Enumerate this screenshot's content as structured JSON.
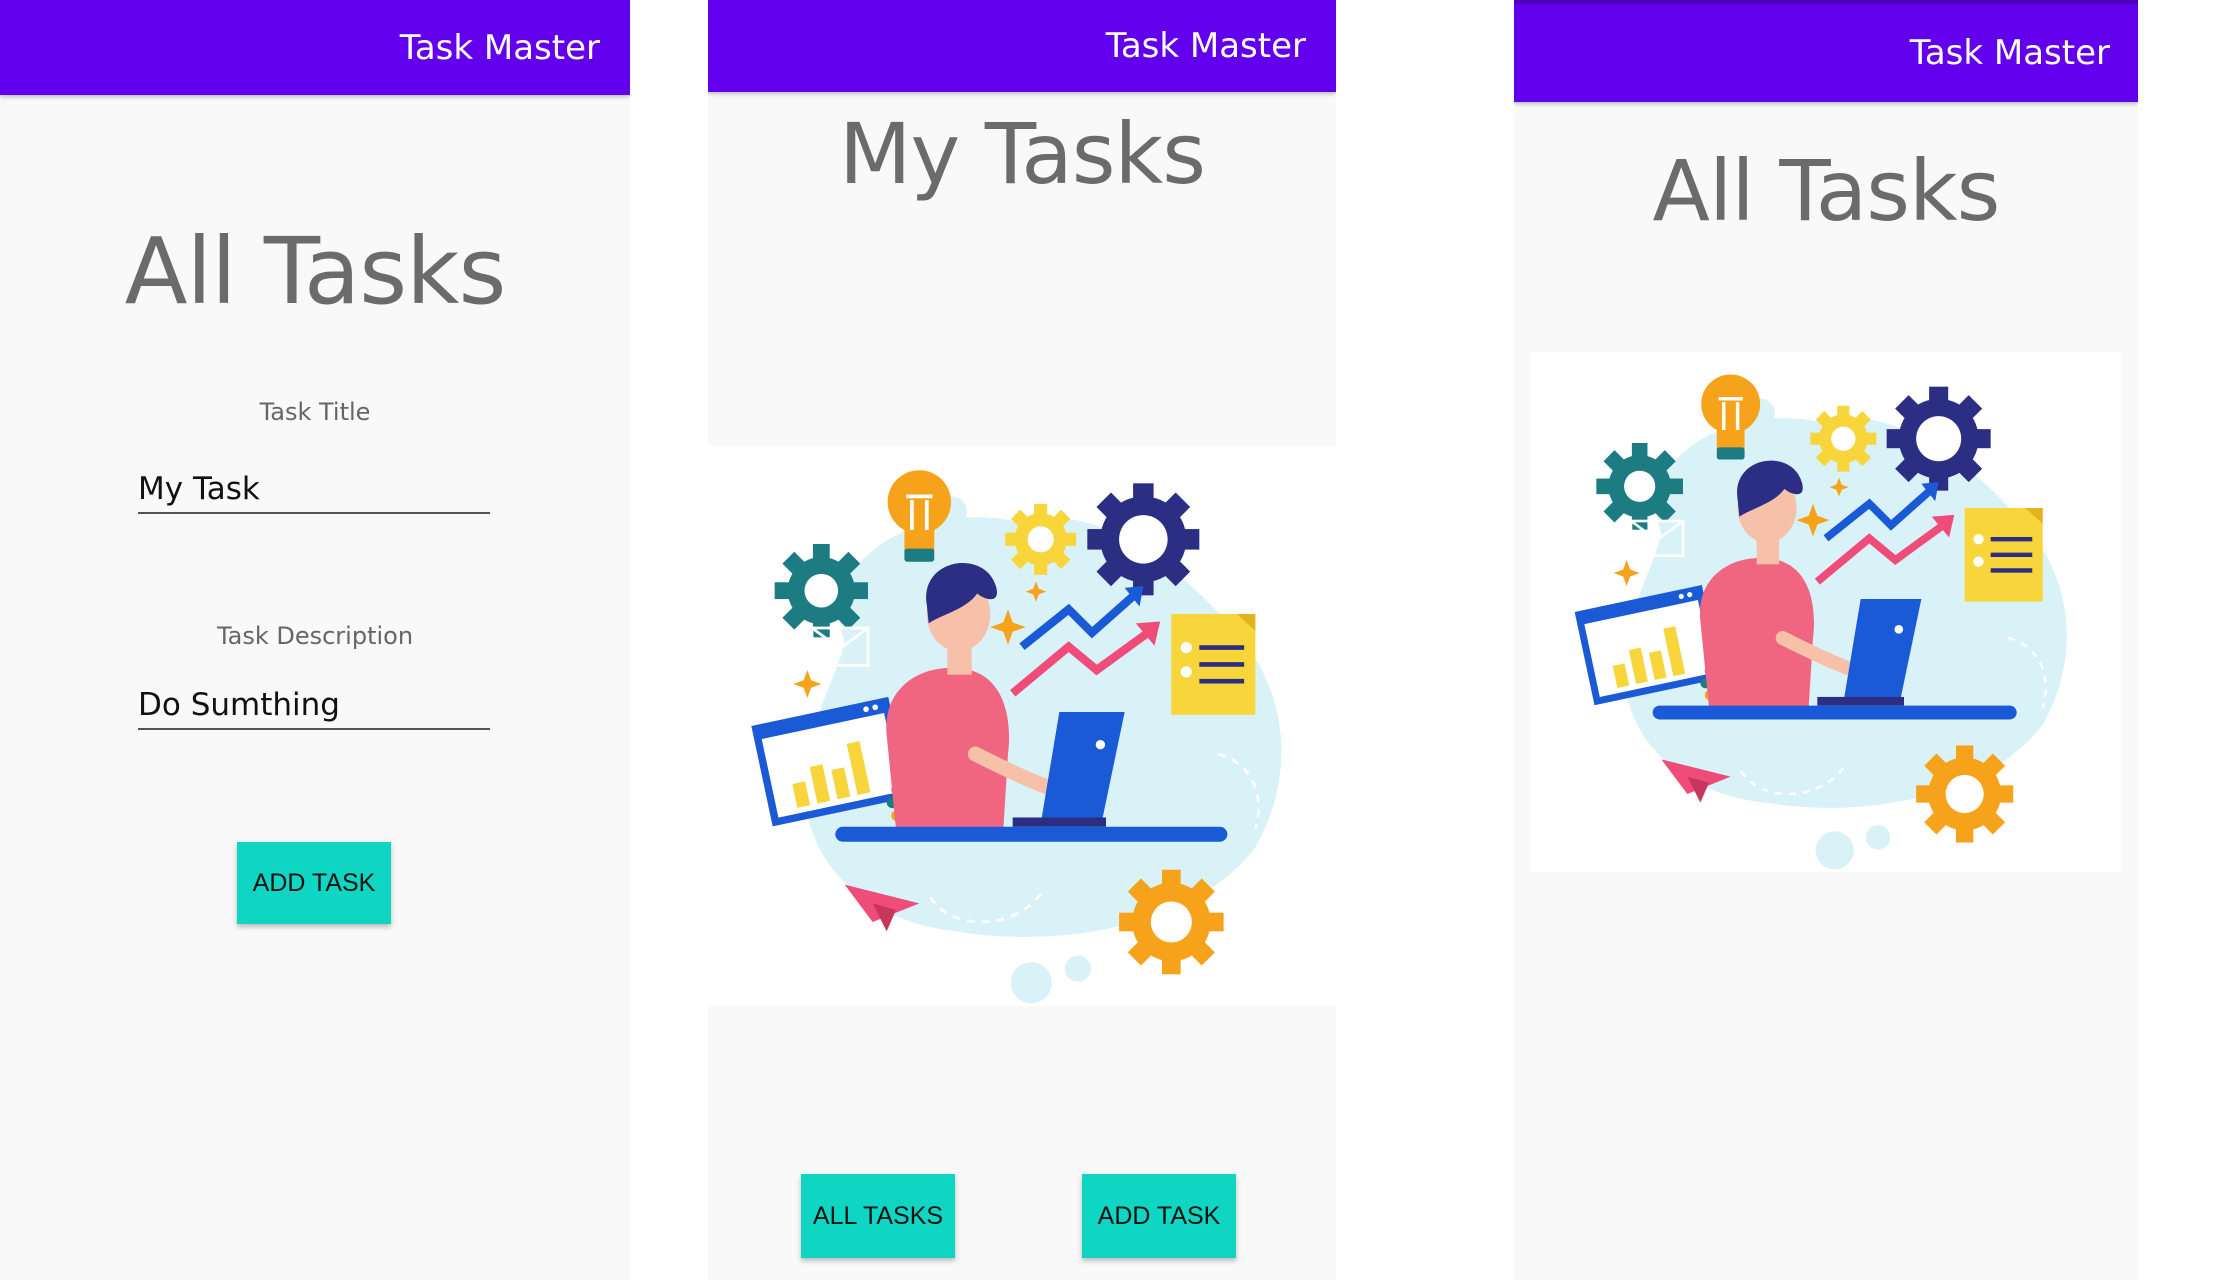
{
  "app": {
    "title": "Task Master"
  },
  "add_task_screen": {
    "heading": "All Tasks",
    "title_label": "Task Title",
    "title_value": "My Task",
    "description_label": "Task Description",
    "description_value": "Do Sumthing",
    "add_button_label": "ADD TASK"
  },
  "home_screen": {
    "heading": "My Tasks",
    "illustration": "person-working-on-laptop-illustration",
    "all_tasks_button_label": "ALL TASKS",
    "add_task_button_label": "ADD TASK"
  },
  "all_tasks_screen": {
    "heading": "All Tasks",
    "illustration": "person-working-on-laptop-illustration"
  },
  "colors": {
    "app_bar": "#6200ee",
    "button": "#0fd6c2",
    "screen_background": "#f9f9f9",
    "heading_text": "#6b6b6b"
  }
}
